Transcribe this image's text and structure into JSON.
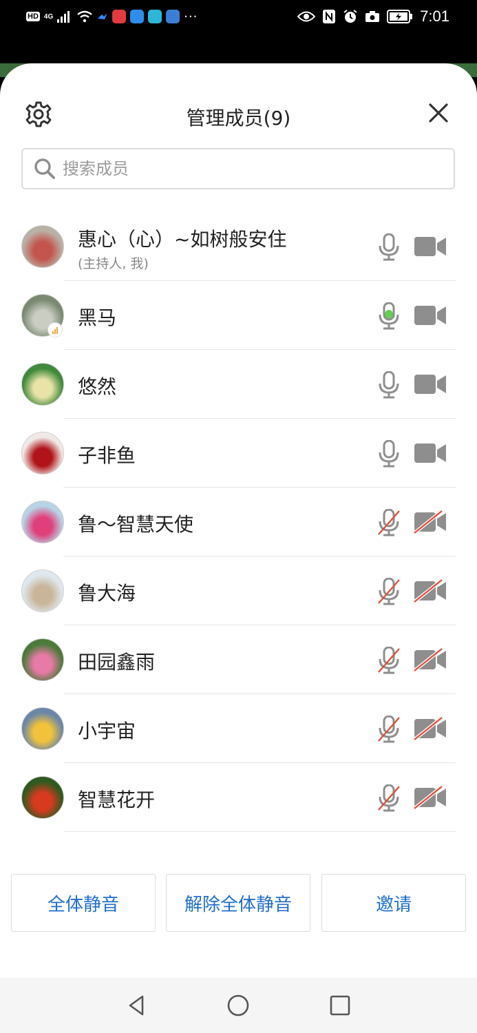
{
  "status_bar": {
    "hd": "HD",
    "network": "4G",
    "time": "7:01",
    "overflow": "···"
  },
  "header": {
    "title": "管理成员(9)"
  },
  "search": {
    "placeholder": "搜索成员"
  },
  "members": [
    {
      "name": "惠心（心）~如树般安住",
      "subtitle": "(主持人, 我)",
      "mic": "on",
      "camera": "on",
      "avatar_colors": [
        "#b9b1a6",
        "#c4554e"
      ]
    },
    {
      "name": "黑马",
      "subtitle": "",
      "mic": "speaking",
      "camera": "on",
      "avatar_colors": [
        "#7a8a72",
        "#c9cdc2"
      ],
      "badge": "signal-icon"
    },
    {
      "name": "悠然",
      "subtitle": "",
      "mic": "on",
      "camera": "on",
      "avatar_colors": [
        "#3f8a3b",
        "#e9e3a8"
      ]
    },
    {
      "name": "子非鱼",
      "subtitle": "",
      "mic": "on",
      "camera": "on",
      "avatar_colors": [
        "#f1e9e6",
        "#b0141a"
      ]
    },
    {
      "name": "鲁～智慧天使",
      "subtitle": "",
      "mic": "muted",
      "camera": "off",
      "avatar_colors": [
        "#b7d3e6",
        "#e0407a"
      ]
    },
    {
      "name": "鲁大海",
      "subtitle": "",
      "mic": "muted",
      "camera": "off",
      "avatar_colors": [
        "#dfe8ee",
        "#c9b59a"
      ]
    },
    {
      "name": "田园鑫雨",
      "subtitle": "",
      "mic": "muted",
      "camera": "off",
      "avatar_colors": [
        "#4b7a3a",
        "#e77aa6"
      ]
    },
    {
      "name": "小宇宙",
      "subtitle": "",
      "mic": "muted",
      "camera": "off",
      "avatar_colors": [
        "#6b87a8",
        "#f2c23a"
      ]
    },
    {
      "name": "智慧花开",
      "subtitle": "",
      "mic": "muted",
      "camera": "off",
      "avatar_colors": [
        "#2f5a1f",
        "#d63a1f"
      ]
    }
  ],
  "actions": {
    "mute_all": "全体静音",
    "unmute_all": "解除全体静音",
    "invite": "邀请"
  },
  "colors": {
    "accent": "#1f6fd1",
    "icon_gray": "#8e8e8e",
    "speaking_green": "#5fd34a",
    "muted_red": "#e0503e"
  }
}
